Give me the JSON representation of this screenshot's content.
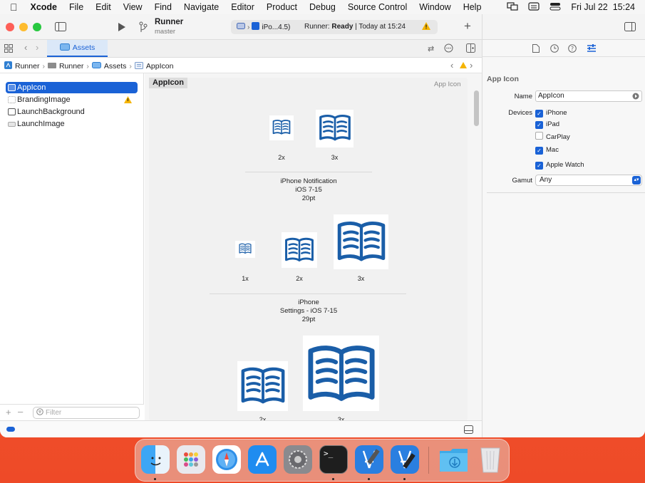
{
  "menubar": {
    "app": "Xcode",
    "items": [
      "File",
      "Edit",
      "View",
      "Find",
      "Navigate",
      "Editor",
      "Product",
      "Debug",
      "Source Control",
      "Window",
      "Help"
    ],
    "clock": "Fri Jul 22  15:24"
  },
  "toolbar": {
    "scheme": "Runner",
    "branch": "master",
    "destination": "iPo...4.5)",
    "status_prefix": "Runner: ",
    "status_bold": "Ready",
    "status_suffix": " | Today at 15:24"
  },
  "tabbar": {
    "tab": "Assets"
  },
  "jumpbar": {
    "crumbs": [
      "Runner",
      "Runner",
      "Assets",
      "AppIcon"
    ]
  },
  "navigator": {
    "items": [
      "AppIcon",
      "BrandingImage",
      "LaunchBackground",
      "LaunchImage"
    ],
    "filter_placeholder": "Filter"
  },
  "editor": {
    "set_name": "AppIcon",
    "set_type": "App Icon",
    "labels": [
      "2x",
      "3x",
      "1x",
      "2x",
      "3x",
      "2x",
      "3x"
    ],
    "group1": [
      "iPhone Notification",
      "iOS 7-15",
      "20pt"
    ],
    "group2": [
      "iPhone",
      "Settings - iOS 7-15",
      "29pt"
    ]
  },
  "inspector": {
    "title": "App Icon",
    "name_label": "Name",
    "name_value": "AppIcon",
    "devices_label": "Devices",
    "devices": [
      {
        "label": "iPhone",
        "checked": true
      },
      {
        "label": "iPad",
        "checked": true
      },
      {
        "label": "CarPlay",
        "checked": false
      },
      {
        "label": "Mac",
        "checked": true
      },
      {
        "label": "Apple Watch",
        "checked": true
      }
    ],
    "gamut_label": "Gamut",
    "gamut_value": "Any"
  },
  "colors": {
    "accent": "#1a62d6",
    "icon_blue": "#1a5ea8",
    "warning": "#f5b400"
  }
}
